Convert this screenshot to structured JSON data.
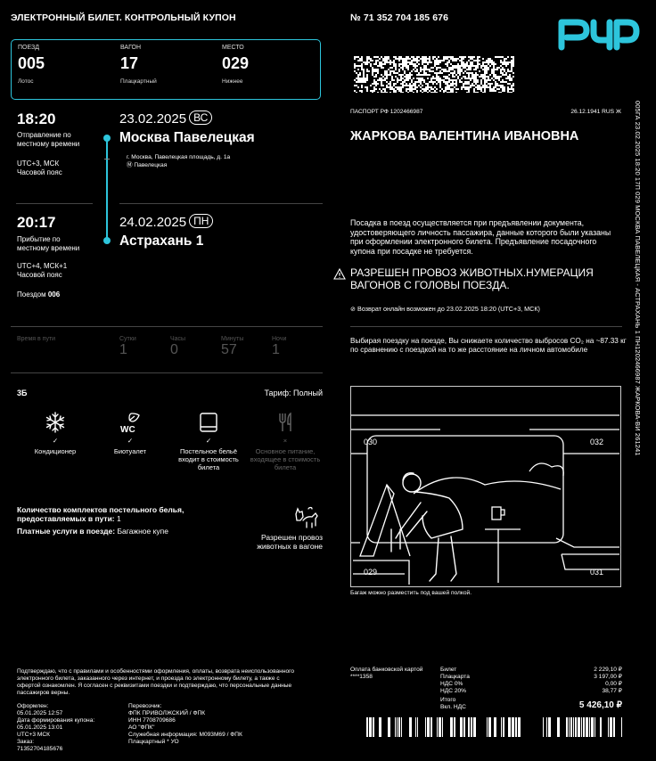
{
  "header": {
    "title": "ЭЛЕКТРОННЫЙ БИЛЕТ. КОНТРОЛЬНЫЙ КУПОН",
    "ticket_number": "№ 71 352 704 185 676"
  },
  "train_info": {
    "train_label": "ПОЕЗД",
    "train_value": "005",
    "train_sub": "Лотос",
    "car_label": "ВАГОН",
    "car_value": "17",
    "car_sub": "Плацкартный",
    "seat_label": "МЕСТО",
    "seat_value": "029",
    "seat_sub": "Нижнее"
  },
  "departure": {
    "time": "18:20",
    "time_note_1": "Отправление по",
    "time_note_2": "местному времени",
    "tz_1": "UTC+3, МСК",
    "tz_2": "Часовой пояс",
    "date": "23.02.2025",
    "dow": "ВС",
    "station": "Москва Павелецкая",
    "address": "г. Москва, Павелецкая площадь, д. 1а",
    "metro": "Ⓜ Павелецкая"
  },
  "arrival": {
    "time": "20:17",
    "time_note_1": "Прибытие по",
    "time_note_2": "местному времени",
    "tz_1": "UTC+4, МСК+1",
    "tz_2": "Часовой пояс",
    "date": "24.02.2025",
    "dow": "ПН",
    "station": "Астрахань 1",
    "train_prefix": "Поездом",
    "train_no": "006"
  },
  "duration": {
    "label": "Время в пути",
    "days_label": "Сутки",
    "days": "1",
    "hours_label": "Часы",
    "hours": "0",
    "minutes_label": "Минуты",
    "minutes": "57",
    "nights_label": "Ночи",
    "nights": "1"
  },
  "service": {
    "class_code": "3Б",
    "tariff": "Тариф: Полный",
    "amenities": [
      {
        "icon": "snowflake-icon",
        "check": "✓",
        "label": "Кондиционер"
      },
      {
        "icon": "wc-icon",
        "icon_text": "WC",
        "check": "✓",
        "label": "Биотуалет"
      },
      {
        "icon": "bedding-icon",
        "check": "✓",
        "label": "Постельное бельё входит в стоимость билета"
      },
      {
        "icon": "fork-knife-icon",
        "check": "×",
        "label": "Основное питание, входящее в стоимость билета"
      }
    ],
    "bedding_text": "Количество комплектов постельного белья, предоставляемых в пути:",
    "bedding_count": "1",
    "paid_label": "Платные услуги в поезде:",
    "paid_value": "Багажное купе",
    "pets_note": "Разрешен провоз животных в вагоне"
  },
  "passenger": {
    "passport": "ПАСПОРТ РФ 1202466987",
    "birth": "26.12.1941 RUS Ж",
    "name": "ЖАРКОВА ВАЛЕНТИНА ИВАНОВНА",
    "boarding_note": "Посадка в поезд осуществляется при предъявлении документа, удостоверяющего личность пассажира, данные которого были указаны при оформлении электронного билета. Предъявление посадочного купона при посадке не требуется.",
    "warning": "РАЗРЕШЕН ПРОВОЗ ЖИВОТНЫХ.НУМЕРАЦИЯ ВАГОНОВ С ГОЛОВЫ ПОЕЗДА.",
    "refund": "⊘ Возврат онлайн возможен до 23.02.2025 18:20 (UTC+3, МСК)",
    "eco_text": "Выбирая поездку на поезде, Вы снижаете количество выбросов CO₂ на ~87.33 кг по сравнению с поездкой на то же расстояние на личном автомобиле"
  },
  "scene": {
    "seats": [
      "030",
      "032",
      "029",
      "031"
    ],
    "caption": "Багаж можно разместить под вашей полкой."
  },
  "side_text": "005ГА 23.02.2025 18:20 17П 029 МОСКВА ПАВЕЛЕЦКАЯ - АСТРАХАНЬ 1 ПН1202466987 ЖАРКОВА-ВИ 261241",
  "footer": {
    "agreement": "Подтверждаю, что с правилами и особенностями оформления, оплаты, возврата неиспользованного электронного билета, заказанного через интернет, и проезда по электронному билету, а также с офертой ознакомлен. Я согласен с реквизитами поездки и подтверждаю, что персональные данные пассажиров верны.",
    "issued_label": "Оформлен:",
    "issued": "05.01.2025 12:57",
    "formed_label": "Дата формирования купона:",
    "formed": "05.01.2025 13:01",
    "formed_tz": "UTC+3 МСК",
    "order_label": "Заказ:",
    "order": "71352704185676",
    "carrier_label": "Перевозчик:",
    "carrier": "ФПК ПРИВОЛЖСКИЙ / ФПК",
    "inn": "ИНН 7708709686",
    "org": "АО \"ФПК\"",
    "service_info": "Служебная информация: М093М69 / ФПК",
    "car_type": "Плацкартный * УО",
    "payment_label": "Оплата банковской картой",
    "card": "****1358",
    "price_rows": [
      {
        "label": "Билет",
        "value": "2 229,10 ₽"
      },
      {
        "label": "Плацкарта",
        "value": "3 197,00 ₽"
      },
      {
        "label": "НДС 0%",
        "value": "0,00 ₽"
      },
      {
        "label": "НДС 20%",
        "value": "38,77 ₽"
      }
    ],
    "total_label": "Итого",
    "vat_label": "Вкл. НДС",
    "total": "5 426,10 ₽"
  },
  "colors": {
    "accent": "#2dc5dc",
    "background": "#000000"
  }
}
